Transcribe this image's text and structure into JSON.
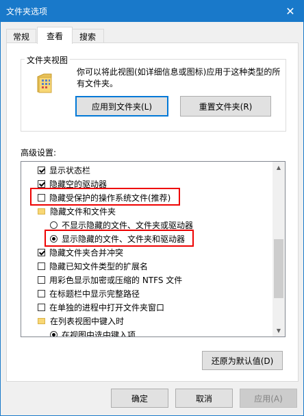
{
  "window": {
    "title": "文件夹选项",
    "close_glyph": "✕"
  },
  "tabs": [
    {
      "label": "常规",
      "active": false
    },
    {
      "label": "查看",
      "active": true
    },
    {
      "label": "搜索",
      "active": false
    }
  ],
  "folder_views": {
    "group_label": "文件夹视图",
    "description": "你可以将此视图(如详细信息或图标)应用于这种类型的所有文件夹。",
    "apply_button": "应用到文件夹(L)",
    "reset_button": "重置文件夹(R)"
  },
  "advanced": {
    "label": "高级设置:",
    "items": [
      {
        "kind": "checkbox",
        "label": "显示状态栏",
        "checked": true,
        "indent": 0
      },
      {
        "kind": "checkbox",
        "label": "隐藏空的驱动器",
        "checked": true,
        "indent": 0
      },
      {
        "kind": "checkbox",
        "label": "隐藏受保护的操作系统文件(推荐)",
        "checked": false,
        "indent": 0,
        "highlight": true
      },
      {
        "kind": "folder",
        "label": "隐藏文件和文件夹",
        "indent": 0
      },
      {
        "kind": "radio",
        "label": "不显示隐藏的文件、文件夹或驱动器",
        "checked": false,
        "indent": 1
      },
      {
        "kind": "radio",
        "label": "显示隐藏的文件、文件夹和驱动器",
        "checked": true,
        "indent": 1,
        "highlight": true
      },
      {
        "kind": "checkbox",
        "label": "隐藏文件夹合并冲突",
        "checked": true,
        "indent": 0
      },
      {
        "kind": "checkbox",
        "label": "隐藏已知文件类型的扩展名",
        "checked": false,
        "indent": 0
      },
      {
        "kind": "checkbox",
        "label": "用彩色显示加密或压缩的 NTFS 文件",
        "checked": false,
        "indent": 0
      },
      {
        "kind": "checkbox",
        "label": "在标题栏中显示完整路径",
        "checked": false,
        "indent": 0
      },
      {
        "kind": "checkbox",
        "label": "在单独的进程中打开文件夹窗口",
        "checked": false,
        "indent": 0
      },
      {
        "kind": "folder",
        "label": "在列表视图中键入时",
        "indent": 0
      },
      {
        "kind": "radio",
        "label": "在视图中选中键入项",
        "checked": true,
        "indent": 1
      }
    ],
    "restore_button": "还原为默认值(D)"
  },
  "footer": {
    "ok": "确定",
    "cancel": "取消",
    "apply": "应用(A)"
  },
  "colors": {
    "titlebar": "#1979ca",
    "highlight_box": "#e00000",
    "focus_border": "#0078d7"
  }
}
